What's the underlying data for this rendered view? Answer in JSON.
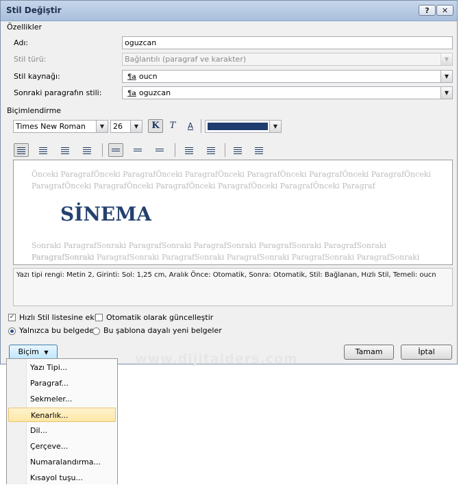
{
  "window": {
    "title": "Stil Değiştir",
    "help_label": "?",
    "close_label": "✕"
  },
  "properties": {
    "group_label": "Özellikler",
    "name_label": "Adı:",
    "name_value": "oguzcan",
    "type_label": "Stil türü:",
    "type_value": "Bağlantılı (paragraf ve karakter)",
    "based_on_label": "Stil kaynağı:",
    "based_on_value": "oucn",
    "next_label": "Sonraki paragrafın stili:",
    "next_value": "oguzcan",
    "style_icon": "¶a"
  },
  "formatting": {
    "group_label": "Biçimlendirme",
    "font": "Times New Roman",
    "size": "26",
    "bold_label": "K",
    "italic_label": "T",
    "underline_label": "A",
    "color_hex": "#1f3c6e",
    "icons": [
      "align-left-icon",
      "align-center-icon",
      "align-right-icon",
      "justify-icon",
      "single-spacing-icon",
      "one-half-spacing-icon",
      "double-spacing-icon",
      "increase-paragraph-spacing-icon",
      "decrease-paragraph-spacing-icon",
      "decrease-indent-icon",
      "increase-indent-icon"
    ]
  },
  "preview": {
    "before_line1": "Önceki ParagrafÖnceki ParagrafÖnceki ParagrafÖnceki ParagrafÖnceki ParagrafÖnceki ParagrafÖnceki",
    "before_line2": "ParagrafÖnceki ParagrafÖnceki ParagrafÖnceki ParagrafÖnceki ParagrafÖnceki Paragraf",
    "sample": "SİNEMA",
    "after_line1": "Sonraki ParagrafSonraki ParagrafSonraki ParagrafSonraki ParagrafSonraki ParagrafSonraki ParagrafSonraki",
    "after_line2": "ParagrafSonraki ParagrafSonraki ParagrafSonraki ParagrafSonraki ParagrafSonraki ParagrafSonraki"
  },
  "description": "Yazı tipi rengi: Metin 2, Girinti: Sol:  1,25 cm, Aralık Önce:  Otomatik, Sonra:  Otomatik, Stil: Bağlanan, Hızlı Stil, Temeli: oucn",
  "options": {
    "quick_style_label": "Hızlı Stil listesine ekle",
    "auto_update_label": "Otomatik olarak güncelleştir",
    "only_doc_label": "Yalnızca bu belgede",
    "template_label": "Bu şablona dayalı yeni belgeler"
  },
  "buttons": {
    "format": "Biçim",
    "ok": "Tamam",
    "cancel": "İptal"
  },
  "watermark": "www.dijitalders.com",
  "menu": {
    "items": [
      "Yazı Tipi...",
      "Paragraf...",
      "Sekmeler...",
      "Kenarlık...",
      "Dil...",
      "Çerçeve...",
      "Numaralandırma...",
      "Kısayol tuşu..."
    ],
    "highlighted": "Kenarlık..."
  }
}
